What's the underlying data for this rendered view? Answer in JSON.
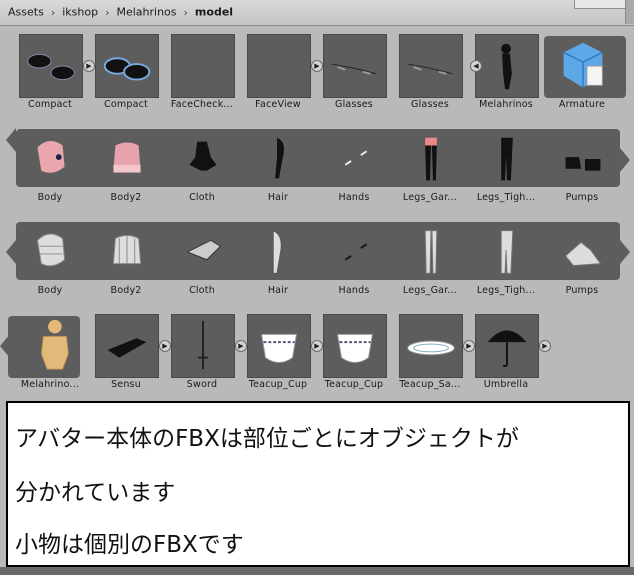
{
  "breadcrumb": [
    "Assets",
    "ikshop",
    "Melahrinos",
    "model"
  ],
  "row1": [
    {
      "label": "Compact",
      "icon": "compact-open-icon",
      "expand": "right"
    },
    {
      "label": "Compact",
      "icon": "compact-closed-icon",
      "expand": ""
    },
    {
      "label": "FaceCheck...",
      "icon": "empty-thumb-icon",
      "expand": ""
    },
    {
      "label": "FaceView",
      "icon": "empty-thumb-icon",
      "expand": "right"
    },
    {
      "label": "Glasses",
      "icon": "glasses-icon",
      "expand": ""
    },
    {
      "label": "Glasses",
      "icon": "glasses-icon",
      "expand": ""
    },
    {
      "label": "Melahrinos",
      "icon": "avatar-figure-icon",
      "expand": "left"
    },
    {
      "label": "Armature",
      "icon": "armature-cube-icon",
      "expand": ""
    }
  ],
  "row2": [
    {
      "label": "Body",
      "icon": "head-skin-icon"
    },
    {
      "label": "Body2",
      "icon": "neck-skin-icon"
    },
    {
      "label": "Cloth",
      "icon": "cloth-icon"
    },
    {
      "label": "Hair",
      "icon": "hair-icon"
    },
    {
      "label": "Hands",
      "icon": "hands-icon"
    },
    {
      "label": "Legs_Gar...",
      "icon": "legs-garter-icon"
    },
    {
      "label": "Legs_Tigh...",
      "icon": "legs-tights-icon"
    },
    {
      "label": "Pumps",
      "icon": "pumps-icon"
    }
  ],
  "row3": [
    {
      "label": "Body",
      "icon": "head-mesh-icon"
    },
    {
      "label": "Body2",
      "icon": "neck-mesh-icon"
    },
    {
      "label": "Cloth",
      "icon": "cloth-mesh-icon"
    },
    {
      "label": "Hair",
      "icon": "hair-mesh-icon"
    },
    {
      "label": "Hands",
      "icon": "hands-mesh-icon"
    },
    {
      "label": "Legs_Gar...",
      "icon": "legs-garter-mesh-icon"
    },
    {
      "label": "Legs_Tigh...",
      "icon": "legs-tights-mesh-icon"
    },
    {
      "label": "Pumps",
      "icon": "pumps-mesh-icon"
    }
  ],
  "row4": [
    {
      "label": "Melahrino...",
      "icon": "avatar-mannequin-icon",
      "expand": ""
    },
    {
      "label": "Sensu",
      "icon": "sensu-fan-icon",
      "expand": "right"
    },
    {
      "label": "Sword",
      "icon": "sword-icon",
      "expand": "right"
    },
    {
      "label": "Teacup_Cup",
      "icon": "teacup-icon",
      "expand": "right"
    },
    {
      "label": "Teacup_Cup",
      "icon": "teacup-icon",
      "expand": ""
    },
    {
      "label": "Teacup_Sa...",
      "icon": "saucer-icon",
      "expand": "right"
    },
    {
      "label": "Umbrella",
      "icon": "umbrella-icon",
      "expand": "right"
    }
  ],
  "caption": [
    "アバター本体のFBXは部位ごとにオブジェクトが",
    "分かれています",
    "小物は個別のFBXです"
  ],
  "colors": {
    "thumb_bg": "#5d5d5d",
    "panel_bg": "#b9b9b9"
  }
}
